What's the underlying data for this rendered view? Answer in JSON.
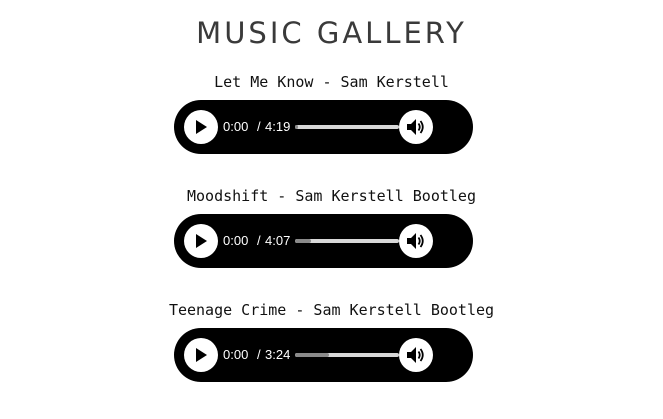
{
  "page": {
    "title": "MUSIC GALLERY"
  },
  "tracks": [
    {
      "title": "Let Me Know - Sam Kerstell",
      "current": "0:00",
      "separator": "/",
      "duration": "4:19",
      "buffered": 0.03
    },
    {
      "title": "Moodshift - Sam Kerstell Bootleg",
      "current": "0:00",
      "separator": "/",
      "duration": "4:07",
      "buffered": 0.15
    },
    {
      "title": "Teenage Crime - Sam Kerstell Bootleg",
      "current": "0:00",
      "separator": "/",
      "duration": "3:24",
      "buffered": 0.33
    }
  ],
  "icons": {
    "play": "play-icon",
    "volume": "volume-icon"
  },
  "colors": {
    "player_bg": "#000000",
    "title_text": "#3a3a3a",
    "track_fill": "#8a8a8a",
    "track_bg": "#d8d8d8"
  }
}
